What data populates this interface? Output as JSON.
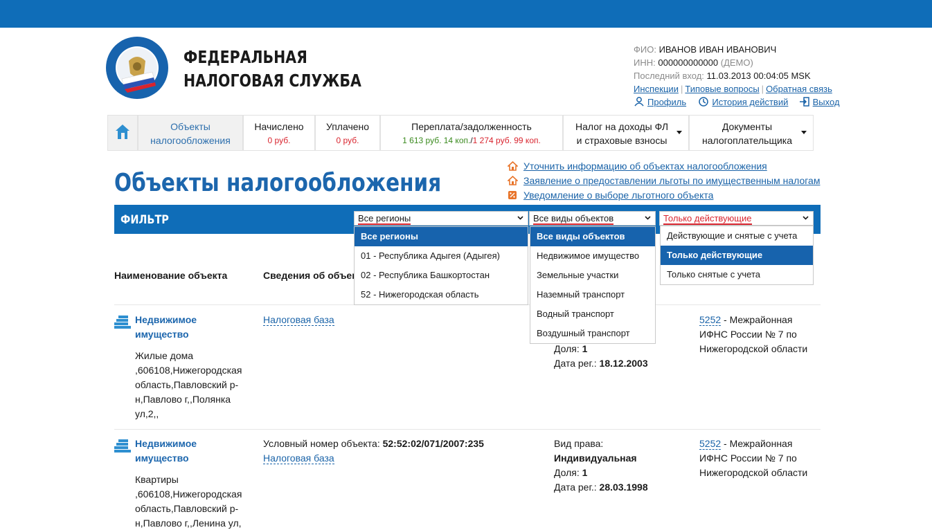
{
  "header": {
    "org_line1": "ФЕДЕРАЛЬНАЯ",
    "org_line2": "НАЛОГОВАЯ СЛУЖБА",
    "logo_text": "ФЕДЕРАЛЬНАЯ НАЛОГОВАЯ СЛУЖБА"
  },
  "user": {
    "fio_label": "ФИО:",
    "fio": "ИВАНОВ ИВАН ИВАНОВИЧ",
    "inn_label": "ИНН:",
    "inn": "000000000000",
    "demo": "(ДЕМО)",
    "last_login_label": "Последний вход:",
    "last_login": "11.03.2013 00:04:05 MSK",
    "links": [
      "Инспекции",
      "Типовые вопросы",
      "Обратная связь"
    ],
    "profile": "Профиль",
    "history": "История действий",
    "logout": "Выход"
  },
  "nav": {
    "tabs": [
      {
        "line1": "Объекты",
        "line2": "налогообложения"
      },
      {
        "line1": "Начислено",
        "line2": "0 руб."
      },
      {
        "line1": "Уплачено",
        "line2": "0 руб."
      },
      {
        "line1": "Переплата/задолженность",
        "overpay": "1 613 руб. 14 коп.",
        "slash": "/",
        "debt": "1 274 руб. 99 коп."
      },
      {
        "line1": "Налог на доходы ФЛ",
        "line2": "и страховые взносы"
      },
      {
        "line1": "Документы",
        "line2": "налогоплательщика"
      }
    ]
  },
  "page": {
    "title": "Объекты налогообложения",
    "links": [
      "Уточнить информацию об объектах налогообложения",
      "Заявление о предоставлении льготы по имущественным налогам",
      "Уведомление о выборе льготного объекта"
    ]
  },
  "filter": {
    "label": "ФИЛЬТР",
    "region": {
      "value": "Все регионы",
      "options": [
        "Все регионы",
        "01 - Республика Адыгея (Адыгея)",
        "02 - Республика Башкортостан",
        "52 - Нижегородская область"
      ]
    },
    "type": {
      "value": "Все виды объектов",
      "options": [
        "Все виды объектов",
        "Недвижимое имущество",
        "Земельные участки",
        "Наземный транспорт",
        "Водный транспорт",
        "Воздушный транспорт"
      ]
    },
    "status": {
      "value": "Только действующие",
      "options": [
        "Действующие и снятые с учета",
        "Только действующие",
        "Только снятые с учета"
      ]
    }
  },
  "table": {
    "headers": [
      "Наименование объекта",
      "Сведения об объекте"
    ],
    "rows": [
      {
        "title_line1": "Недвижимое",
        "title_line2": "имущество",
        "address": [
          "Жилые дома",
          ",606108,Нижегородская",
          "область,Павловский р-",
          "н,Павлово г,,Полянка",
          "ул,2,,"
        ],
        "cond_label": "",
        "cond_value": "",
        "tax_base": "Налоговая база",
        "right_label": "",
        "right_value": "",
        "share_label": "Доля:",
        "share_value": "1",
        "reg_label": "Дата рег.:",
        "reg_value": "18.12.2003",
        "ifns_code": "5252",
        "ifns": [
          "- Межрайонная",
          "ИФНС России № 7 по",
          "Нижегородской области"
        ]
      },
      {
        "title_line1": "Недвижимое",
        "title_line2": "имущество",
        "address": [
          "Квартиры",
          ",606108,Нижегородская",
          "область,Павловский р-",
          "н,Павлово г,,Ленина ул,"
        ],
        "cond_label": "Условный номер объекта:",
        "cond_value": "52:52:02/071/2007:235",
        "tax_base": "Налоговая база",
        "right_label": "Вид права:",
        "right_value": "Индивидуальная",
        "share_label": "Доля:",
        "share_value": "1",
        "reg_label": "Дата рег.:",
        "reg_value": "28.03.1998",
        "ifns_code": "5252",
        "ifns": [
          "- Межрайонная",
          "ИФНС России № 7 по",
          "Нижегородской области"
        ]
      }
    ]
  },
  "colors": {
    "brand_blue": "#0f6db8",
    "title_blue": "#1c66ad",
    "link_blue": "#1a63a8",
    "red": "#d9242e",
    "green": "#3a8a1e",
    "icon_orange": "#e8742a"
  }
}
